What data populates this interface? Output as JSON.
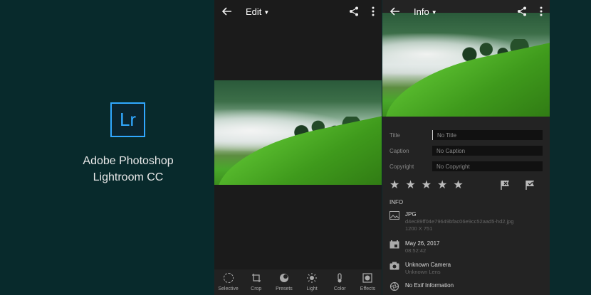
{
  "promo": {
    "logo_text": "Lr",
    "title_line1": "Adobe Photoshop",
    "title_line2": "Lightroom CC"
  },
  "edit_panel": {
    "title": "Edit",
    "tools": [
      {
        "label": "Selective",
        "icon": "selective-icon"
      },
      {
        "label": "Crop",
        "icon": "crop-icon"
      },
      {
        "label": "Presets",
        "icon": "presets-icon"
      },
      {
        "label": "Light",
        "icon": "light-icon"
      },
      {
        "label": "Color",
        "icon": "color-icon"
      },
      {
        "label": "Effects",
        "icon": "effects-icon"
      }
    ]
  },
  "info_panel": {
    "title": "Info",
    "fields": [
      {
        "label": "Title",
        "placeholder": "No Title"
      },
      {
        "label": "Caption",
        "placeholder": "No Caption"
      },
      {
        "label": "Copyright",
        "placeholder": "No Copyright"
      }
    ],
    "rating": {
      "stars": 5,
      "value": 0
    },
    "section_label": "INFO",
    "file": {
      "type": "JPG",
      "id": "d4ec89ff04e79649bfac06e9cc52aad5-hd2.jpg",
      "dimensions": "1200 X 751"
    },
    "date": {
      "day": "May 26, 2017",
      "time": "08:52:42"
    },
    "camera": {
      "name": "Unknown Camera",
      "lens": "Unknown Lens"
    },
    "exif": {
      "label": "No Exif Information"
    }
  },
  "colors": {
    "background": "#0a2a2c",
    "lr_accent": "#31a8ff",
    "panel_dark": "#1b1b1b",
    "info_panel": "#232323"
  }
}
